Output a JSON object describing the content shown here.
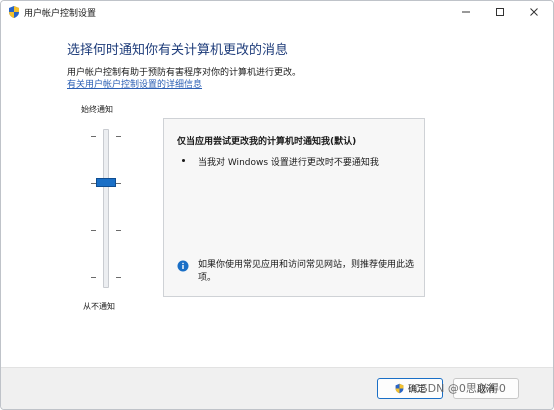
{
  "window": {
    "title": "用户帐户控制设置",
    "controls": [
      "minimize-icon",
      "maximize-icon",
      "close-icon"
    ]
  },
  "content": {
    "heading": "选择何时通知你有关计算机更改的消息",
    "description": "用户帐户控制有助于预防有害程序对你的计算机进行更改。",
    "link": "有关用户帐户控制设置的详细信息"
  },
  "slider": {
    "top_label": "始终通知",
    "bottom_label": "从不通知",
    "levels": 4,
    "selected_level": 3
  },
  "panel": {
    "title": "仅当应用尝试更改我的计算机时通知我(默认)",
    "bullet": "当我对 Windows 设置进行更改时不要通知我",
    "note": "如果你使用常见应用和访问常见网站，则推荐使用此选项。",
    "note_icon": "info-icon"
  },
  "footer": {
    "ok_label": "确定",
    "ok_icon": "uac-shield-icon",
    "cancel_label": "取消"
  },
  "watermark": "CSDN @0思必得0",
  "colors": {
    "heading": "#1e3c7a",
    "link": "#2b5fb4",
    "accent": "#1a6fc6"
  }
}
